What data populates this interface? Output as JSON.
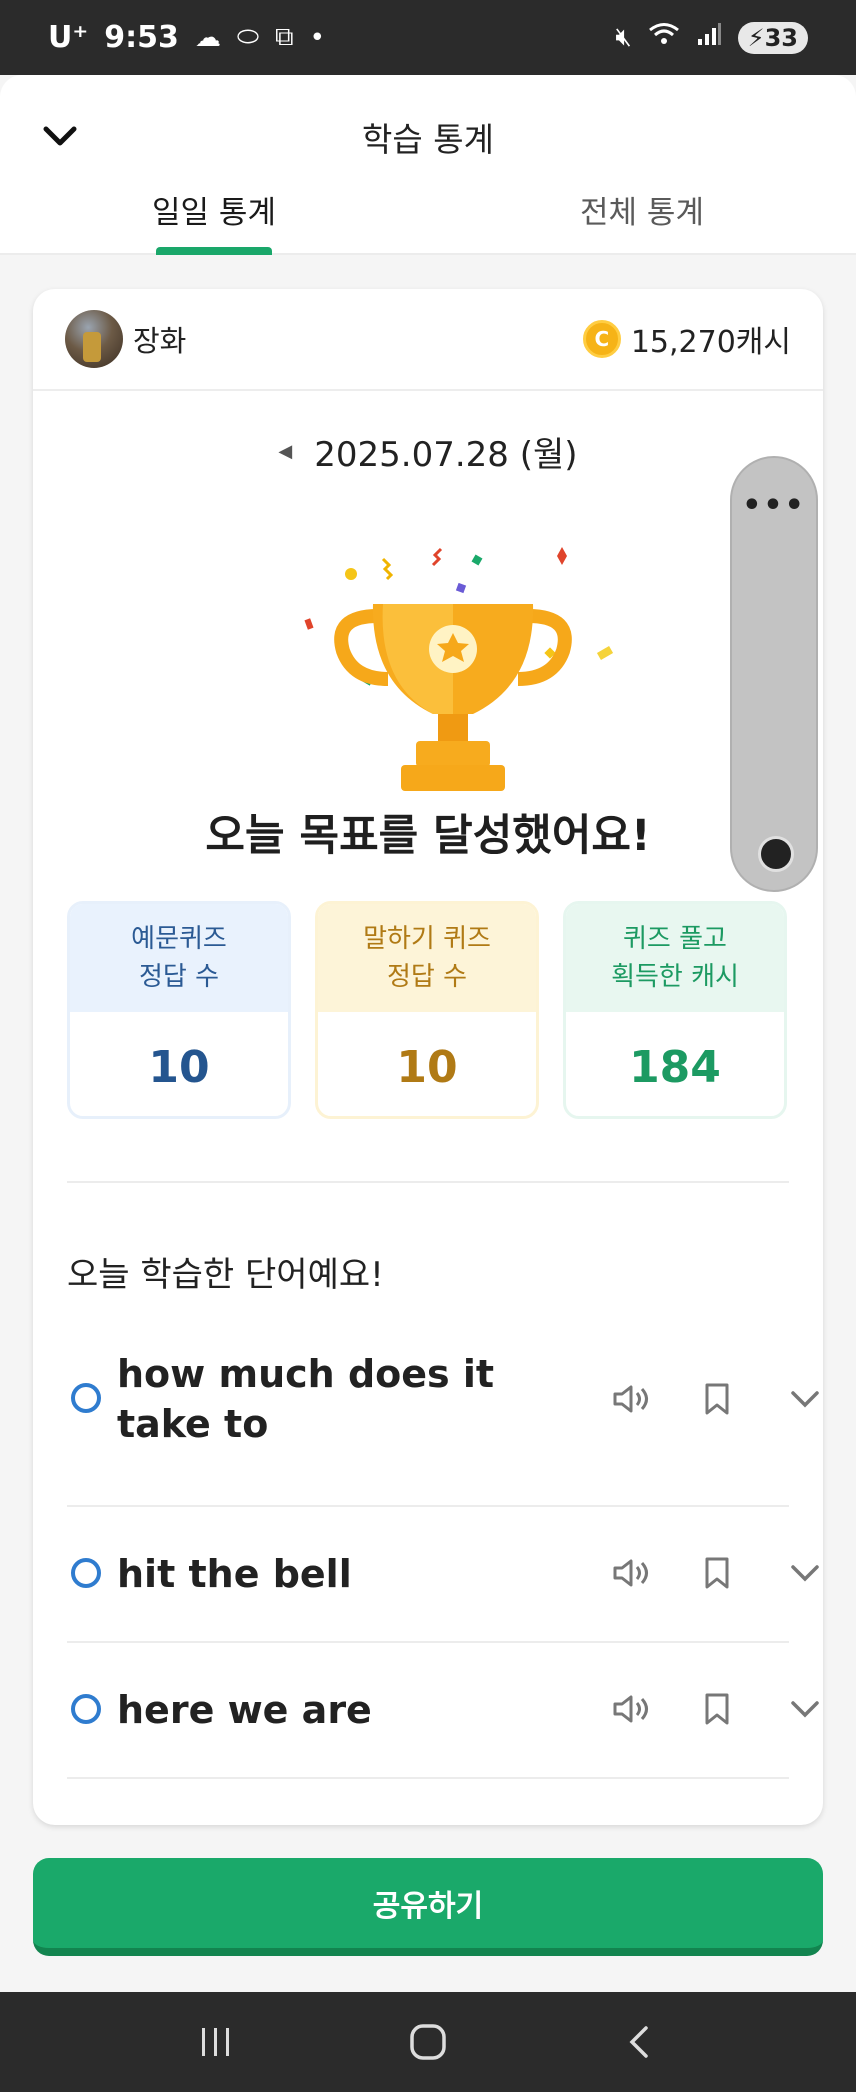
{
  "status_bar": {
    "carrier": "U⁺",
    "time": "9:53",
    "battery": "33"
  },
  "header": {
    "title": "학습 통계",
    "tabs": [
      {
        "label": "일일 통계",
        "active": true
      },
      {
        "label": "전체 통계",
        "active": false
      }
    ]
  },
  "user": {
    "name": "장화",
    "cash": "15,270캐시"
  },
  "date": "2025.07.28 (월)",
  "goal_message": "오늘 목표를 달성했어요!",
  "stats": [
    {
      "label": "예문퀴즈\n정답 수",
      "value": "10"
    },
    {
      "label": "말하기 퀴즈\n정답 수",
      "value": "10"
    },
    {
      "label": "퀴즈 풀고\n획득한 캐시",
      "value": "184"
    }
  ],
  "words_title": "오늘 학습한 단어예요!",
  "words": [
    {
      "text": "how much does it take to"
    },
    {
      "text": "hit the bell"
    },
    {
      "text": "here we are"
    }
  ],
  "share_label": "공유하기",
  "side_widget": {
    "menu": "•••"
  },
  "colors": {
    "accent_green": "#1aa96a",
    "blue": "#24558f",
    "yellow": "#b07a15",
    "green": "#1c9a62",
    "trophy": "#f7ab1e"
  }
}
